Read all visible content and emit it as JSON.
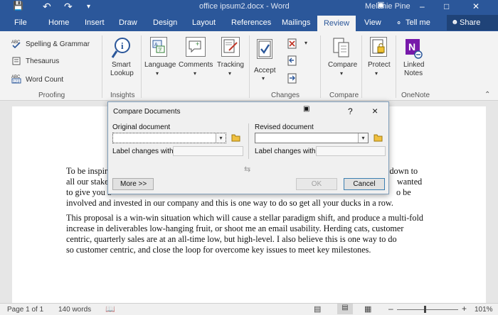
{
  "titlebar": {
    "doc_title": "office ipsum2.docx - Word",
    "user_name": "Melanie Pine",
    "window_controls": [
      "minimize-icon",
      "maximize-icon",
      "close-icon"
    ]
  },
  "tabs": {
    "file": "File",
    "home": "Home",
    "insert": "Insert",
    "draw": "Draw",
    "design": "Design",
    "layout": "Layout",
    "references": "References",
    "mailings": "Mailings",
    "review": "Review",
    "view": "View",
    "tell_me": "Tell me",
    "share": "Share"
  },
  "ribbon": {
    "spelling": "Spelling & Grammar",
    "thesaurus": "Thesaurus",
    "word_count": "Word Count",
    "proofing": "Proofing",
    "smart_lookup_1": "Smart",
    "smart_lookup_2": "Lookup",
    "insights": "Insights",
    "language": "Language",
    "comments": "Comments",
    "tracking": "Tracking",
    "accept": "Accept",
    "changes": "Changes",
    "compare_btn": "Compare",
    "compare_group": "Compare",
    "protect": "Protect",
    "linked_notes_1": "Linked",
    "linked_notes_2": "Notes",
    "onenote": "OneNote",
    "icons": [
      "abc-check-icon",
      "thesaurus-icon",
      "word-count-icon",
      "smart-lookup-icon",
      "language-icon",
      "comment-icon",
      "tracking-icon",
      "accept-icon",
      "reject-icon",
      "previous-change-icon",
      "next-change-icon",
      "compare-icon",
      "protect-icon",
      "onenote-icon"
    ],
    "accent_onenote": "#7719aa"
  },
  "document": {
    "p1_l1_a": "To be inspir",
    "p1_l1_b": "e down to",
    "p1_l2_a": "all our stakel",
    "p1_l2_b": "wanted",
    "p1_l3_a": "to give you a",
    "p1_l3_b": "o be",
    "p1_l4": "involved and invested in our company and this is one way to do so get all your ducks in a row.",
    "p2_l1": "This proposal is a win-win situation which will cause a stellar paradigm shift, and produce a multi-fold",
    "p2_l2": "increase in deliverables low-hanging fruit, or shoot me an email usability.  Herding cats, customer",
    "p2_l3": "centric, quarterly sales are at an all-time low, but high-level.  I also believe this is one way to do",
    "p2_l4": "so customer centric, and close the loop for overcome key issues to meet key milestones."
  },
  "dialog": {
    "title": "Compare Documents",
    "help": "?",
    "close": "×",
    "original_label": "Original document",
    "revised_label": "Revised document",
    "label_changes_left": "Label changes with",
    "label_changes_right": "Label changes with",
    "original_value": "",
    "revised_value": "",
    "more_button": "More >>",
    "ok_button": "OK",
    "cancel_button": "Cancel"
  },
  "statusbar": {
    "page": "Page 1 of 1",
    "words": "140 words",
    "zoom": "101%"
  }
}
